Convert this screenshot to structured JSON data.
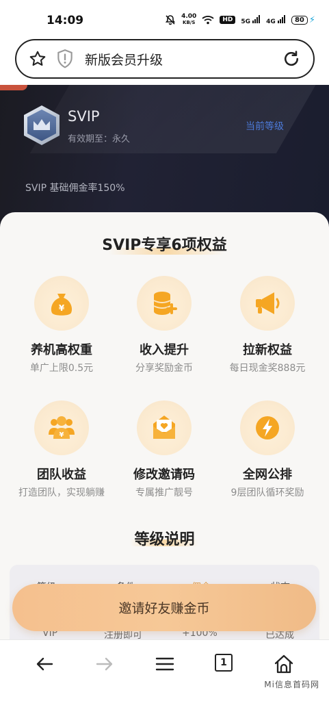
{
  "status_bar": {
    "time": "14:09",
    "net_speed_value": "4.00",
    "net_speed_unit": "KB/S",
    "hd_label": "HD",
    "signal1_label": "5G",
    "signal2_label": "4G",
    "battery": "80",
    "icons": [
      "mute-bell-icon",
      "wifi-icon",
      "signal-icon",
      "battery-icon",
      "charging-icon"
    ]
  },
  "browser": {
    "page_title": "新版会员升级",
    "icons": [
      "star-icon",
      "shield-icon",
      "refresh-icon"
    ]
  },
  "membership": {
    "level": "SVIP",
    "validity": "有效期至：永久",
    "current_level_label": "当前等级",
    "commission_rate": "SVIP 基础佣金率150%"
  },
  "benefits_section": {
    "title": "SVIP专享6项权益",
    "items": [
      {
        "icon": "money-bag-icon",
        "title": "养机高权重",
        "subtitle": "单广上限0.5元"
      },
      {
        "icon": "coins-plus-icon",
        "title": "收入提升",
        "subtitle": "分享奖励金币"
      },
      {
        "icon": "megaphone-icon",
        "title": "拉新权益",
        "subtitle": "每日现金奖888元"
      },
      {
        "icon": "team-icon",
        "title": "团队收益",
        "subtitle": "打造团队，实现躺赚"
      },
      {
        "icon": "envelope-heart-icon",
        "title": "修改邀请码",
        "subtitle": "专属推广靓号"
      },
      {
        "icon": "lightning-icon",
        "title": "全网公排",
        "subtitle": "9层团队循环奖励"
      }
    ]
  },
  "level_section": {
    "title": "等级说明",
    "headers": [
      "等级",
      "条件",
      "佣金",
      "状态"
    ],
    "row": [
      "VIP",
      "注册即可",
      "+100%",
      "已达成"
    ]
  },
  "cta": {
    "label": "邀请好友赚金币"
  },
  "bottom_nav": {
    "items": [
      "back-arrow-icon",
      "forward-arrow-icon",
      "menu-icon",
      "tabs-icon",
      "home-icon"
    ],
    "tab_count": "1"
  },
  "watermark": "Mi信息首码网",
  "colors": {
    "hero_bg": "#1d1f2c",
    "accent_blue": "#4c7ad9",
    "cta_gradient_start": "#f5c08e",
    "icon_orange": "#f5a623"
  }
}
